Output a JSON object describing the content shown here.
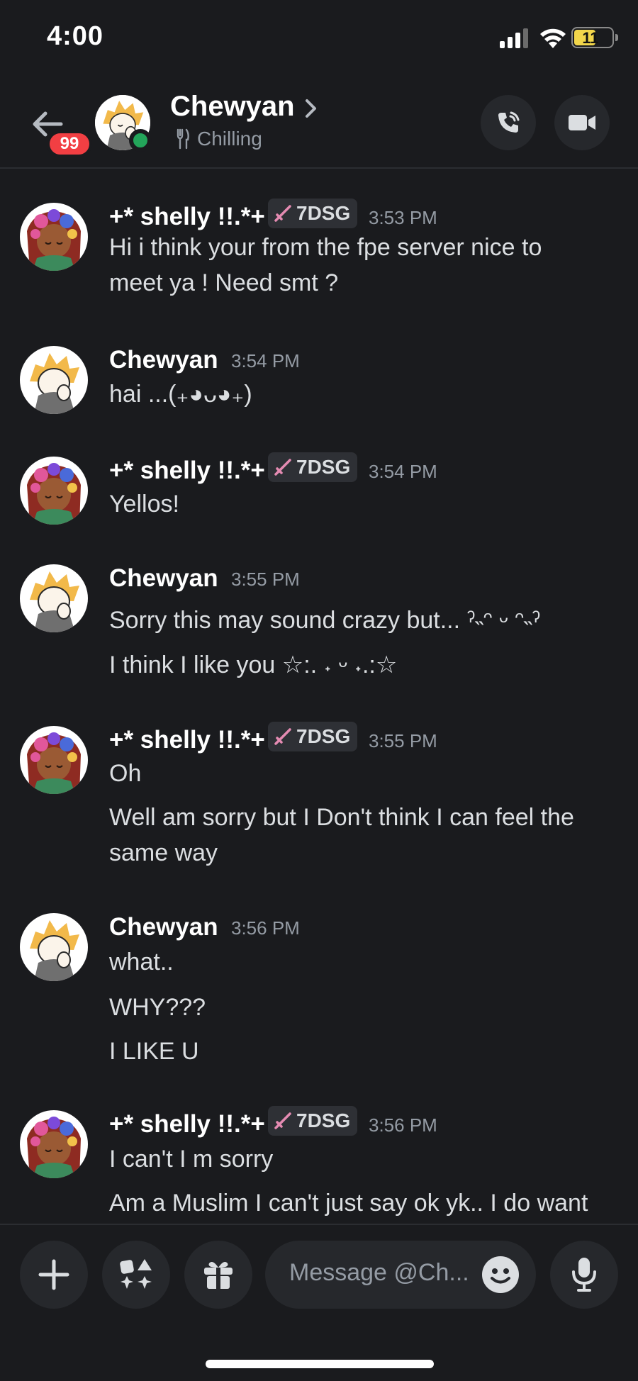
{
  "status_bar": {
    "time": "4:00",
    "battery": "11"
  },
  "header": {
    "unread_count": "99",
    "name": "Chewyan",
    "status_text": "Chilling",
    "icons": [
      "back-arrow-icon",
      "chevron-right-icon",
      "fork-knife-icon",
      "voice-call-icon",
      "video-call-icon"
    ]
  },
  "messages": [
    {
      "author": "+* shelly !!.*+",
      "tag": "7DSG",
      "time": "3:53 PM",
      "lines": [
        "Hi i think your from the fpe server nice to",
        "meet ya ! Need smt ?"
      ]
    },
    {
      "author": "Chewyan",
      "time": "3:54 PM",
      "lines": [
        "hai ...(₊◕ᴗ◕₊)"
      ]
    },
    {
      "author": "+* shelly !!.*+",
      "tag": "7DSG",
      "time": "3:54 PM",
      "lines": [
        "Yellos!"
      ]
    },
    {
      "author": "Chewyan",
      "time": "3:55 PM",
      "lines": [
        "Sorry this may sound crazy but... ˀ˵ᵔ ᵕ ᵔ˵ˀ",
        "I think I like you ☆:. ˖ ᵕ ˖.:☆"
      ]
    },
    {
      "author": "+* shelly !!.*+",
      "tag": "7DSG",
      "time": "3:55 PM",
      "lines": [
        "Oh",
        "Well am sorry but I Don't think I can feel the",
        "same way"
      ]
    },
    {
      "author": "Chewyan",
      "time": "3:56 PM",
      "lines": [
        "what..",
        "WHY???",
        "I LIKE U"
      ]
    },
    {
      "author": "+* shelly !!.*+",
      "tag": "7DSG",
      "time": "3:56 PM",
      "lines": [
        "I can't I m sorry",
        "Am a Muslim I can't just say ok yk.. I do want"
      ]
    }
  ],
  "composer": {
    "placeholder": "Message @Ch..."
  },
  "colors": {
    "background": "#1a1b1e",
    "online": "#23a55a",
    "badge": "#f23f43",
    "muted_text": "#949ba4"
  }
}
